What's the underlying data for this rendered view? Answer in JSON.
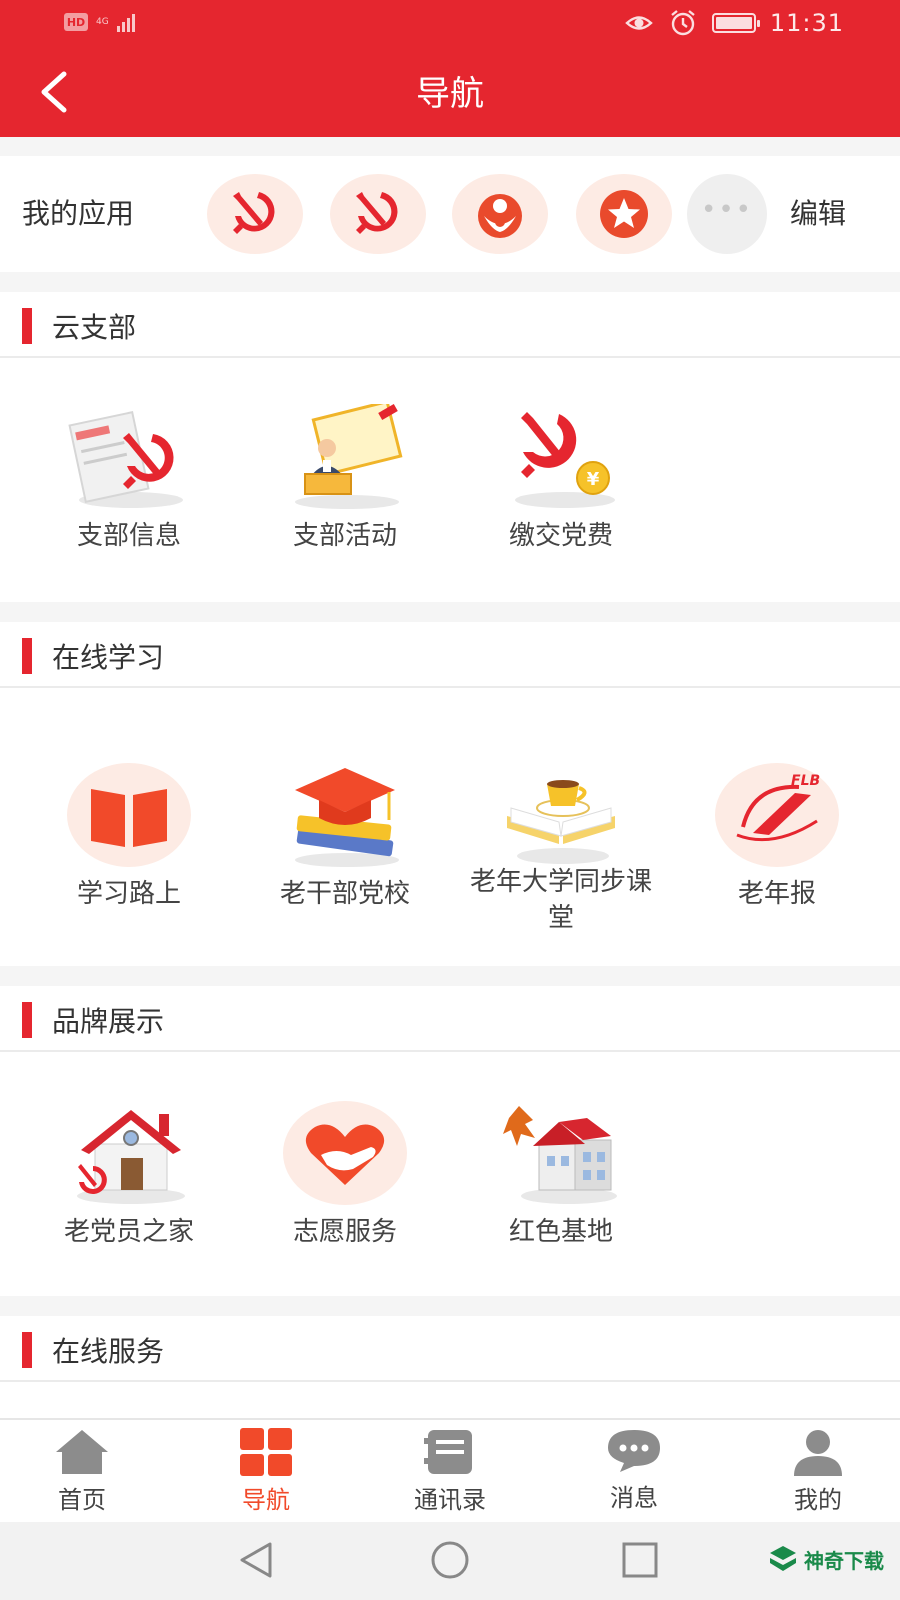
{
  "status_bar": {
    "network_badge": "HD",
    "network_type": "4G",
    "time": "11:31"
  },
  "header": {
    "title": "导航"
  },
  "my_apps": {
    "label": "我的应用",
    "edit_label": "编辑",
    "slots": [
      {
        "icon": "hammer-sickle-icon"
      },
      {
        "icon": "hammer-sickle-icon"
      },
      {
        "icon": "people-icon"
      },
      {
        "icon": "star-icon"
      },
      {
        "icon": "more-icon"
      }
    ]
  },
  "sections": [
    {
      "title": "云支部",
      "items": [
        {
          "label": "支部信息",
          "icon": "branch-info-icon"
        },
        {
          "label": "支部活动",
          "icon": "branch-activity-icon"
        },
        {
          "label": "缴交党费",
          "icon": "party-fee-icon"
        }
      ]
    },
    {
      "title": "在线学习",
      "items": [
        {
          "label": "学习路上",
          "icon": "book-icon"
        },
        {
          "label": "老干部党校",
          "icon": "graduation-cap-icon"
        },
        {
          "label": "老年大学同步课堂",
          "icon": "open-book-coffee-icon"
        },
        {
          "label": "老年报",
          "icon": "newspaper-logo-icon"
        }
      ]
    },
    {
      "title": "品牌展示",
      "items": [
        {
          "label": "老党员之家",
          "icon": "house-icon"
        },
        {
          "label": "志愿服务",
          "icon": "heart-hand-icon"
        },
        {
          "label": "红色基地",
          "icon": "building-icon"
        }
      ]
    },
    {
      "title": "在线服务",
      "items": []
    }
  ],
  "tabbar": {
    "active": "导航",
    "tabs": [
      {
        "label": "首页",
        "icon": "home-icon"
      },
      {
        "label": "导航",
        "icon": "grid-icon"
      },
      {
        "label": "通讯录",
        "icon": "contacts-icon"
      },
      {
        "label": "消息",
        "icon": "message-icon"
      },
      {
        "label": "我的",
        "icon": "user-icon"
      }
    ]
  },
  "watermark": {
    "text": "神奇下载"
  },
  "colors": {
    "primary": "#e5262f",
    "tab_active": "#f14a2a",
    "icon_bg": "#fdebe4"
  }
}
